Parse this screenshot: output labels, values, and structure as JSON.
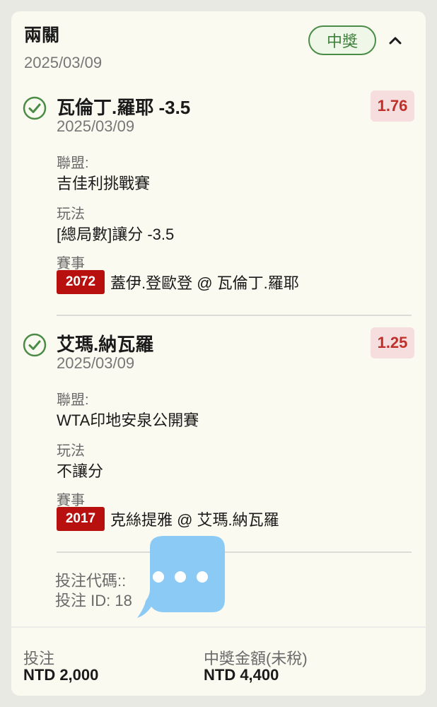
{
  "header": {
    "title": "兩關",
    "date": "2025/03/09",
    "status_badge": "中獎"
  },
  "legs": [
    {
      "name": "瓦倫丁.羅耶 -3.5",
      "date": "2025/03/09",
      "odds": "1.76",
      "league_label": "聯盟:",
      "league": "吉佳利挑戰賽",
      "play_label": "玩法",
      "play": "[總局數]讓分 -3.5",
      "event_label": "賽事",
      "event_id": "2072",
      "event_name": "蓋伊.登歐登 @ 瓦倫丁.羅耶"
    },
    {
      "name": "艾瑪.納瓦羅",
      "date": "2025/03/09",
      "odds": "1.25",
      "league_label": "聯盟:",
      "league": "WTA印地安泉公開賽",
      "play_label": "玩法",
      "play": "不讓分",
      "event_label": "賽事",
      "event_id": "2017",
      "event_name": "克絲提雅 @ 艾瑪.納瓦羅"
    }
  ],
  "bet_code_label": "投注代碼::",
  "bet_id_label": "投注 ID: 18",
  "footer": {
    "stake_label": "投注",
    "stake_value": "NTD 2,000",
    "payout_label": "中獎金額(未稅)",
    "payout_value": "NTD 4,400"
  },
  "colors": {
    "win_green": "#4a8c46",
    "odds_red": "#c0302a",
    "event_red": "#b80f0f",
    "chat_blue": "#8ccaf6"
  }
}
